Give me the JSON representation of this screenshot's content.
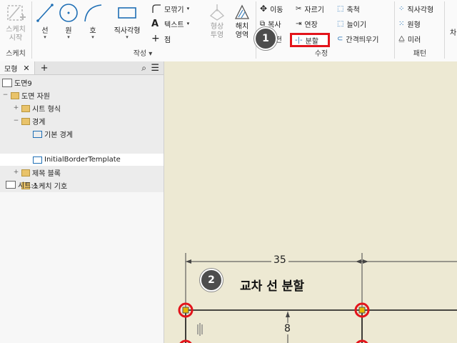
{
  "ribbon": {
    "sketch_panel": {
      "start_sketch": "스케치\n시작",
      "title": "스케치"
    },
    "create_panel": {
      "line": "선",
      "circle": "원",
      "arc": "호",
      "rectangle": "직사각형",
      "fillet": "모깎기",
      "text": "텍스트",
      "point": "점",
      "project_geometry": "형상\n투영",
      "hatch": "해치\n영역",
      "title": "작성"
    },
    "modify_panel": {
      "move": "이동",
      "trim": "자르기",
      "scale": "축척",
      "copy": "복사",
      "extend": "연장",
      "stretch": "늘이기",
      "rotate": "회전",
      "split": "분할",
      "offset": "간격띄우기",
      "title": "수정"
    },
    "pattern_panel": {
      "rect_pattern": "직사각형",
      "circ_pattern": "원형",
      "mirror": "미러",
      "title": "패턴"
    },
    "cut_off": "차"
  },
  "browser": {
    "tab_label": "모형",
    "tree": [
      {
        "label": "도면9",
        "level": 0
      },
      {
        "label": "도면 자원",
        "level": 0
      },
      {
        "label": "시트 형식",
        "level": 1
      },
      {
        "label": "경계",
        "level": 1
      },
      {
        "label": "기본 경계",
        "level": 2
      },
      {
        "label": "InitialBorderTemplate",
        "level": 2
      },
      {
        "label": "제목 블록",
        "level": 1
      },
      {
        "label": "스케치 기호",
        "level": 1
      },
      {
        "label": "시트:1",
        "level": 0
      }
    ]
  },
  "canvas": {
    "dim_horizontal": "35",
    "dim_vertical": "8",
    "callout_text": "교차 선 분할"
  },
  "callouts": {
    "step1": "1",
    "step2": "2"
  },
  "colors": {
    "highlight": "#e3141b",
    "ribbon_blue": "#1f6fb5",
    "canvas_bg": "#ede9d3",
    "badge": "#4d4d4d"
  }
}
